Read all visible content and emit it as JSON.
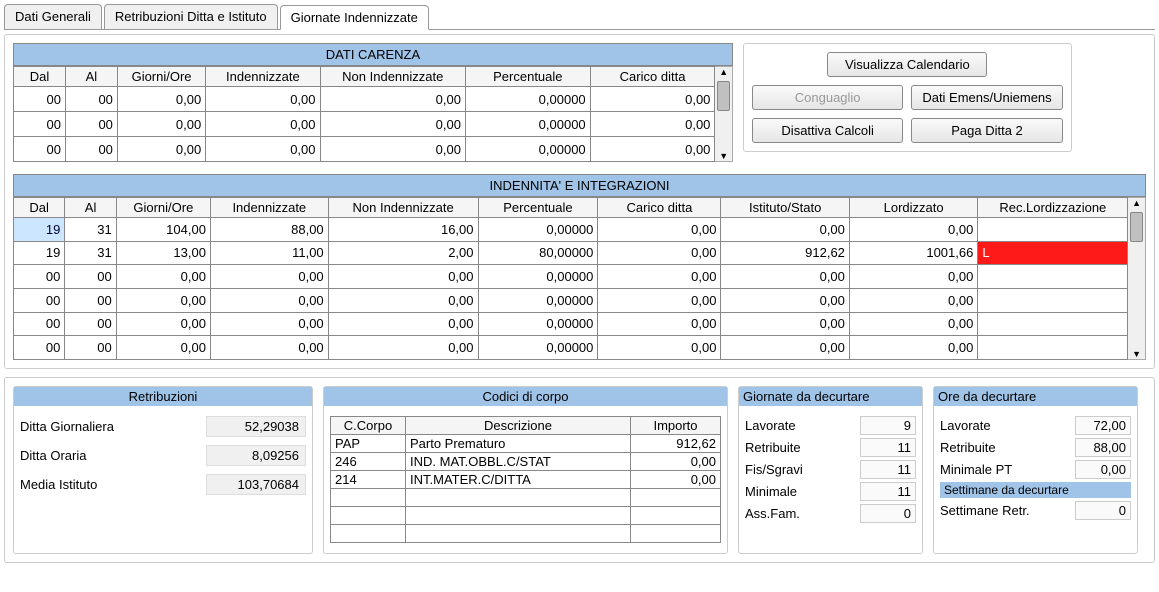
{
  "tabs": {
    "t1": "Dati Generali",
    "t2": "Retribuzioni Ditta e Istituto",
    "t3": "Giornate Indennizzate"
  },
  "carenza": {
    "title": "DATI CARENZA",
    "headers": [
      "Dal",
      "Al",
      "Giorni/Ore",
      "Indennizzate",
      "Non Indennizzate",
      "Percentuale",
      "Carico ditta"
    ],
    "rows": [
      [
        "00",
        "00",
        "0,00",
        "0,00",
        "0,00",
        "0,00000",
        "0,00"
      ],
      [
        "00",
        "00",
        "0,00",
        "0,00",
        "0,00",
        "0,00000",
        "0,00"
      ],
      [
        "00",
        "00",
        "0,00",
        "0,00",
        "0,00",
        "0,00000",
        "0,00"
      ]
    ]
  },
  "indenn": {
    "title": "INDENNITA' E INTEGRAZIONI",
    "headers": [
      "Dal",
      "Al",
      "Giorni/Ore",
      "Indennizzate",
      "Non Indennizzate",
      "Percentuale",
      "Carico ditta",
      "Istituto/Stato",
      "Lordizzato",
      "Rec.Lordizzazione"
    ],
    "rows": [
      {
        "c": [
          "19",
          "31",
          "104,00",
          "88,00",
          "16,00",
          "0,00000",
          "0,00",
          "0,00",
          "0,00",
          ""
        ],
        "sel": 0
      },
      {
        "c": [
          "19",
          "31",
          "13,00",
          "11,00",
          "2,00",
          "80,00000",
          "0,00",
          "912,62",
          "1001,66",
          "L"
        ],
        "red": 9
      },
      {
        "c": [
          "00",
          "00",
          "0,00",
          "0,00",
          "0,00",
          "0,00000",
          "0,00",
          "0,00",
          "0,00",
          ""
        ]
      },
      {
        "c": [
          "00",
          "00",
          "0,00",
          "0,00",
          "0,00",
          "0,00000",
          "0,00",
          "0,00",
          "0,00",
          ""
        ]
      },
      {
        "c": [
          "00",
          "00",
          "0,00",
          "0,00",
          "0,00",
          "0,00000",
          "0,00",
          "0,00",
          "0,00",
          ""
        ]
      },
      {
        "c": [
          "00",
          "00",
          "0,00",
          "0,00",
          "0,00",
          "0,00000",
          "0,00",
          "0,00",
          "0,00",
          ""
        ]
      }
    ]
  },
  "buttons": {
    "vis": "Visualizza Calendario",
    "cong": "Conguaglio",
    "emens": "Dati Emens/Uniemens",
    "dis": "Disattiva Calcoli",
    "paga": "Paga Ditta 2"
  },
  "retrib": {
    "title": "Retribuzioni",
    "ditta_g_lbl": "Ditta Giornaliera",
    "ditta_g_val": "52,29038",
    "ditta_o_lbl": "Ditta Oraria",
    "ditta_o_val": "8,09256",
    "media_lbl": "Media Istituto",
    "media_val": "103,70684"
  },
  "corpo": {
    "title": "Codici di corpo",
    "headers": [
      "C.Corpo",
      "Descrizione",
      "Importo"
    ],
    "rows": [
      [
        "PAP",
        "Parto Prematuro",
        "912,62"
      ],
      [
        "246",
        "IND. MAT.OBBL.C/STAT",
        "0,00"
      ],
      [
        "214",
        "INT.MATER.C/DITTA",
        "0,00"
      ]
    ]
  },
  "gdec": {
    "title": "Giornate da decurtare",
    "lav_l": "Lavorate",
    "lav_v": "9",
    "ret_l": "Retribuite",
    "ret_v": "11",
    "fis_l": "Fis/Sgravi",
    "fis_v": "11",
    "min_l": "Minimale",
    "min_v": "11",
    "ass_l": "Ass.Fam.",
    "ass_v": "0"
  },
  "odec": {
    "title": "Ore da decurtare",
    "lav_l": "Lavorate",
    "lav_v": "72,00",
    "ret_l": "Retribuite",
    "ret_v": "88,00",
    "min_l": "Minimale PT",
    "min_v": "0,00",
    "sett_hdr": "Settimane da decurtare",
    "sett_l": "Settimane Retr.",
    "sett_v": "0"
  }
}
